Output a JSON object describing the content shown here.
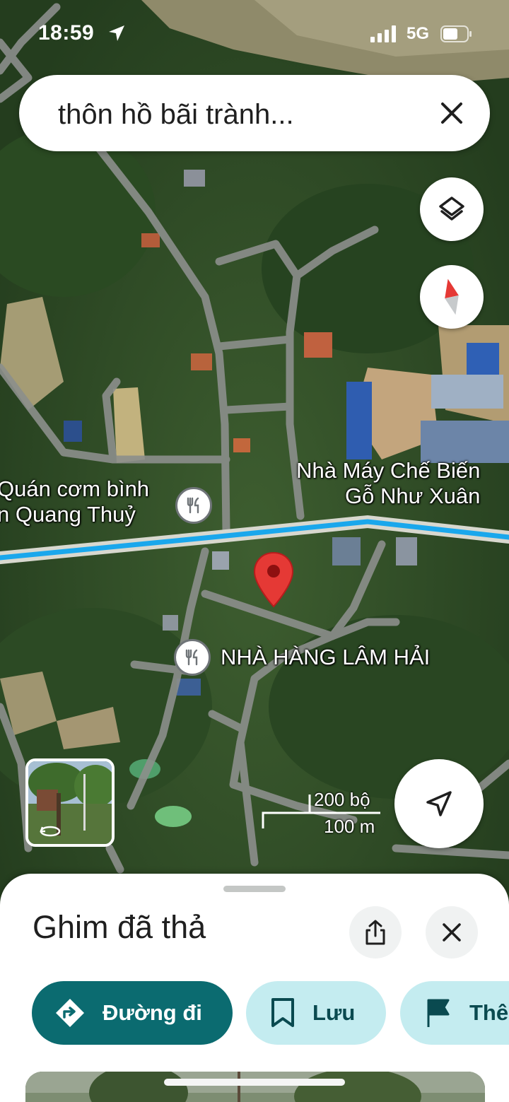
{
  "status_bar": {
    "time": "18:59",
    "network": "5G",
    "location_icon": "location-arrow-icon",
    "signal_icon": "signal-bars-icon",
    "battery_icon": "battery-icon"
  },
  "search": {
    "query": "thôn hồ bãi trành...",
    "clear_icon": "close-icon"
  },
  "map": {
    "labels": {
      "poi_restaurant_1_line1": "Quán cơm bình",
      "poi_restaurant_1_line2": "n Quang Thuỷ",
      "poi_factory_line1": "Nhà Máy Chế Biến",
      "poi_factory_line2": "Gỗ Như Xuân",
      "poi_restaurant_2": "NHÀ HÀNG LÂM HẢI"
    },
    "scale": {
      "imperial": "200 bộ",
      "metric": "100 m"
    },
    "buttons": {
      "layers_icon": "layers-icon",
      "compass_icon": "compass-icon",
      "my_location_icon": "navigation-arrow-icon",
      "street_view_icon": "street-view-rotate-icon"
    },
    "colors": {
      "route": "#1aa7ec",
      "pin": "#e53935"
    }
  },
  "sheet": {
    "title": "Ghim đã thả",
    "share_icon": "share-icon",
    "close_icon": "close-icon",
    "chips": {
      "directions": "Đường đi",
      "save": "Lưu",
      "more": "Thê"
    },
    "colors": {
      "primary": "#0b6b70",
      "tonal": "#c4ecf0"
    }
  }
}
